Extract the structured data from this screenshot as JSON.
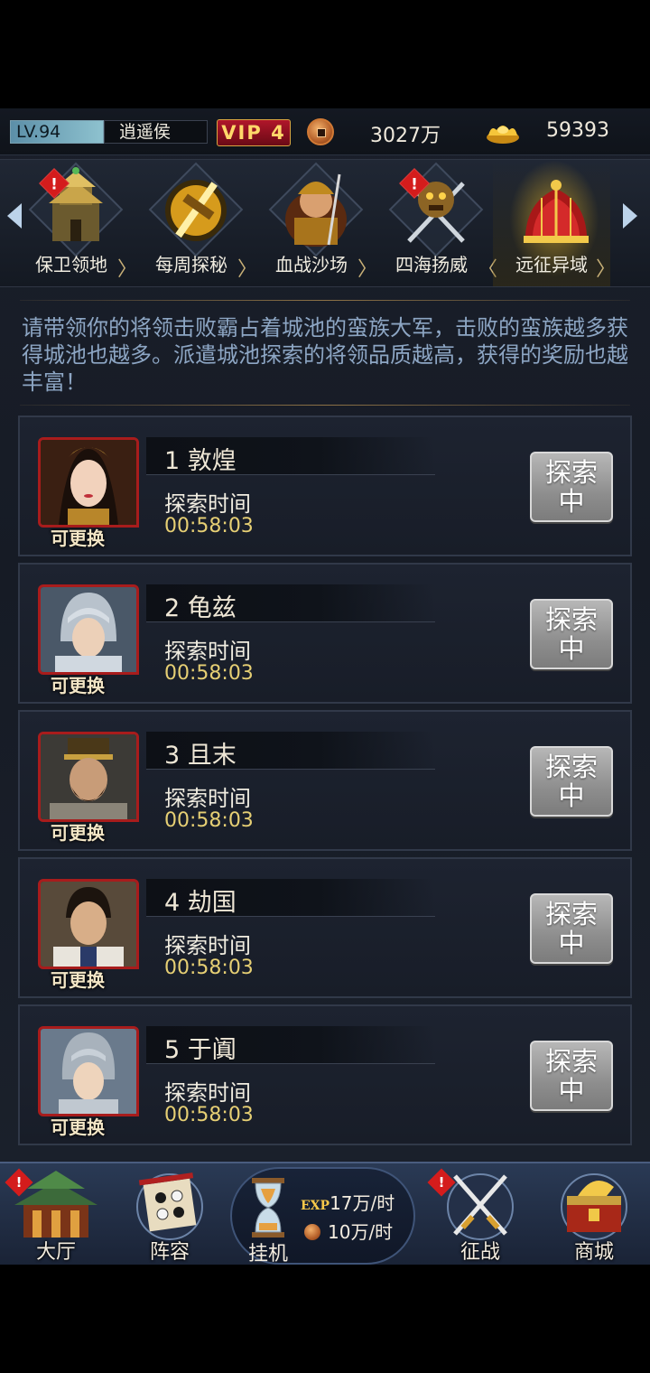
{
  "status": {
    "level": "LV.94",
    "title": "逍遥侯",
    "vip": "VIP 4",
    "copper": "3027万",
    "gold": "59393"
  },
  "tabs": [
    {
      "label": "保卫领地",
      "icon": "fortress-icon",
      "badge": true,
      "active": false
    },
    {
      "label": "每周探秘",
      "icon": "golden-weapon-icon",
      "badge": false,
      "active": false
    },
    {
      "label": "血战沙场",
      "icon": "warrior-icon",
      "badge": false,
      "active": false
    },
    {
      "label": "四海扬威",
      "icon": "crossed-swords-beast-icon",
      "badge": true,
      "active": false
    },
    {
      "label": "远征异域",
      "icon": "war-tent-icon",
      "badge": false,
      "active": true
    }
  ],
  "description": "请带领你的将领击败霸占着城池的蛮族大军，击败的蛮族越多获得城池也越多。派遣城池探索的将领品质越高，获得的奖励也越丰富！",
  "cities": [
    {
      "name": "1 敦煌",
      "time_label": "探索时间",
      "time": "00:58:03",
      "swap": "可更换",
      "button": "探索中"
    },
    {
      "name": "2 龟兹",
      "time_label": "探索时间",
      "time": "00:58:03",
      "swap": "可更换",
      "button": "探索中"
    },
    {
      "name": "3 且末",
      "time_label": "探索时间",
      "time": "00:58:03",
      "swap": "可更换",
      "button": "探索中"
    },
    {
      "name": "4 劫国",
      "time_label": "探索时间",
      "time": "00:58:03",
      "swap": "可更换",
      "button": "探索中"
    },
    {
      "name": "5 于阗",
      "time_label": "探索时间",
      "time": "00:58:03",
      "swap": "可更换",
      "button": "探索中"
    }
  ],
  "nav": {
    "hall": "大厅",
    "lineup": "阵容",
    "idle": "挂机",
    "exp_tag": "EXP",
    "exp_rate": "17万/时",
    "coin_rate": "10万/时",
    "campaign": "征战",
    "shop": "商城"
  },
  "colors": {
    "accent_gold": "#e6cf74",
    "badge_red": "#d41c1c",
    "description_blue": "#8da6c4"
  }
}
